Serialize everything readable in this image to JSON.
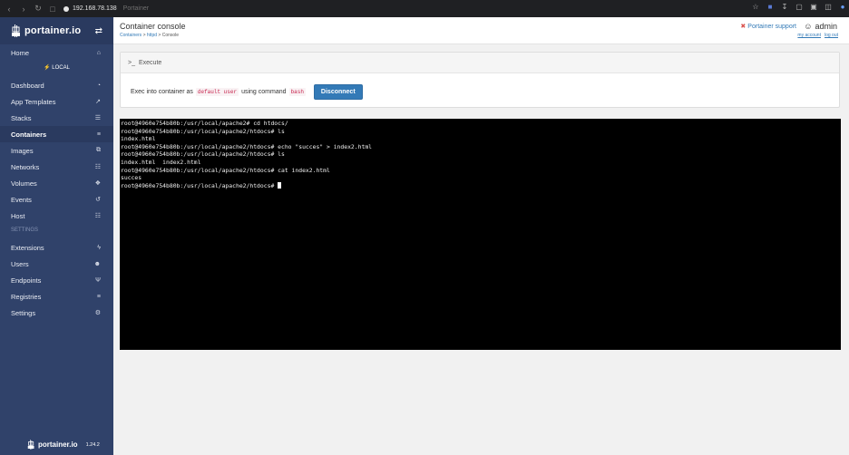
{
  "browser": {
    "url_host": "192.168.78.138",
    "tab_title": "Portainer"
  },
  "sidebar": {
    "logo_text": "portainer.io",
    "home_label": "Home",
    "endpoint_label": "LOCAL",
    "items": [
      {
        "label": "Dashboard",
        "icon": "tachometer-icon"
      },
      {
        "label": "App Templates",
        "icon": "rocket-icon"
      },
      {
        "label": "Stacks",
        "icon": "th-list-icon"
      },
      {
        "label": "Containers",
        "icon": "server-icon",
        "active": true
      },
      {
        "label": "Images",
        "icon": "clone-icon"
      },
      {
        "label": "Networks",
        "icon": "sitemap-icon"
      },
      {
        "label": "Volumes",
        "icon": "cubes-icon"
      },
      {
        "label": "Events",
        "icon": "history-icon"
      },
      {
        "label": "Host",
        "icon": "th-icon"
      }
    ],
    "settings_section": "SETTINGS",
    "settings_items": [
      {
        "label": "Extensions",
        "icon": "bolt-icon"
      },
      {
        "label": "Users",
        "icon": "users-icon"
      },
      {
        "label": "Endpoints",
        "icon": "plug-icon"
      },
      {
        "label": "Registries",
        "icon": "database-icon"
      },
      {
        "label": "Settings",
        "icon": "cogs-icon"
      }
    ],
    "footer_logo": "portainer.io",
    "version": "1.24.2"
  },
  "header": {
    "title": "Container console",
    "breadcrumb_1": "Containers",
    "breadcrumb_sep1": " > ",
    "breadcrumb_2": "httpd",
    "breadcrumb_sep2": " > ",
    "breadcrumb_3": "Console",
    "support_label": "Portainer support",
    "username": "admin",
    "my_account": "my account",
    "log_out": "log out"
  },
  "execute": {
    "heading": "Execute",
    "text_prefix": "Exec into container as",
    "user": "default user",
    "text_mid": "using command",
    "command": "bash",
    "disconnect_label": "Disconnect"
  },
  "terminal": {
    "lines": [
      "root@4960e754b80b:/usr/local/apache2# cd htdocs/",
      "root@4960e754b80b:/usr/local/apache2/htdocs# ls",
      "index.html",
      "root@4960e754b80b:/usr/local/apache2/htdocs# echo \"succes\" > index2.html",
      "root@4960e754b80b:/usr/local/apache2/htdocs# ls",
      "index.html  index2.html",
      "root@4960e754b80b:/usr/local/apache2/htdocs# cat index2.html",
      "succes",
      "root@4960e754b80b:/usr/local/apache2/htdocs# "
    ]
  },
  "colors": {
    "sidebar_bg": "#30426a",
    "accent": "#337ab7",
    "terminal_bg": "#000000"
  }
}
